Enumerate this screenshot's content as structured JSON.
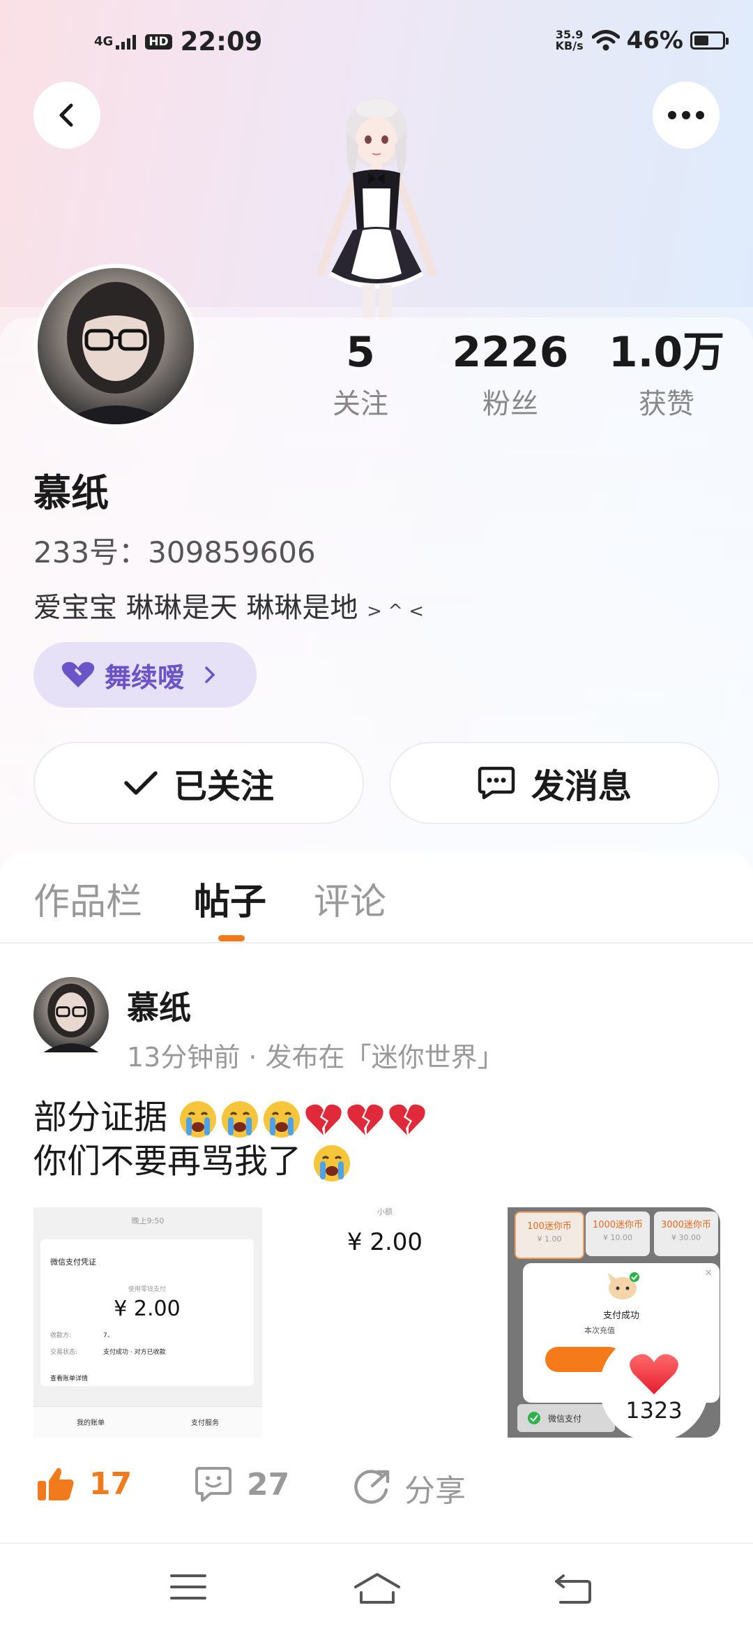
{
  "status_bar": {
    "network": "4G",
    "hd": "HD",
    "time": "22:09",
    "speed_value": "35.9",
    "speed_unit": "KB/s",
    "battery": "46%"
  },
  "profile": {
    "stats": [
      {
        "value": "5",
        "label": "关注"
      },
      {
        "value": "2226",
        "label": "粉丝"
      },
      {
        "value": "1.0万",
        "label": "获赞"
      }
    ],
    "nickname": "慕纸",
    "uid": "233号：309859606",
    "bio": "爱宝宝 琳琳是天 琳琳是地",
    "bio_kaomoji": "> ^ <",
    "tag": "舞续嗳",
    "follow_button": "已关注",
    "message_button": "发消息"
  },
  "tabs": [
    {
      "label": "作品栏",
      "active": false
    },
    {
      "label": "帖子",
      "active": true
    },
    {
      "label": "评论",
      "active": false
    }
  ],
  "post": {
    "author": "慕纸",
    "meta": "13分钟前 · 发布在「迷你世界」",
    "line1": "部分证据",
    "line2": "你们不要再骂我了",
    "images": {
      "tile1": {
        "header": "晚上9:50",
        "title": "微信支付凭证",
        "subtitle": "使用零钱支付",
        "amount": "¥ 2.00",
        "row1_label": "收款方:",
        "row1_value": "7、",
        "row2_label": "交易状态:",
        "row2_value": "支付成功 · 对方已收款",
        "link": "查看账单详情",
        "footer_left": "我的账单",
        "footer_right": "支付服务"
      },
      "tile2": {
        "top": "小额",
        "amount": "¥ 2.00"
      },
      "tile3": {
        "options": [
          {
            "top": "100迷你币",
            "bottom": "¥ 1.00"
          },
          {
            "top": "1000迷你币",
            "bottom": "¥ 10.00"
          },
          {
            "top": "3000迷你币",
            "bottom": "¥ 30.00"
          }
        ],
        "dialog_title": "支付成功",
        "dialog_sub": "本次充值",
        "pay_method": "微信支付"
      }
    },
    "float_like_count": "1323",
    "likes": "17",
    "comments": "27",
    "share": "分享"
  },
  "colors": {
    "accent": "#f07a1c",
    "tag_bg": "#e7e1f8",
    "tag_text": "#6b53c8"
  }
}
